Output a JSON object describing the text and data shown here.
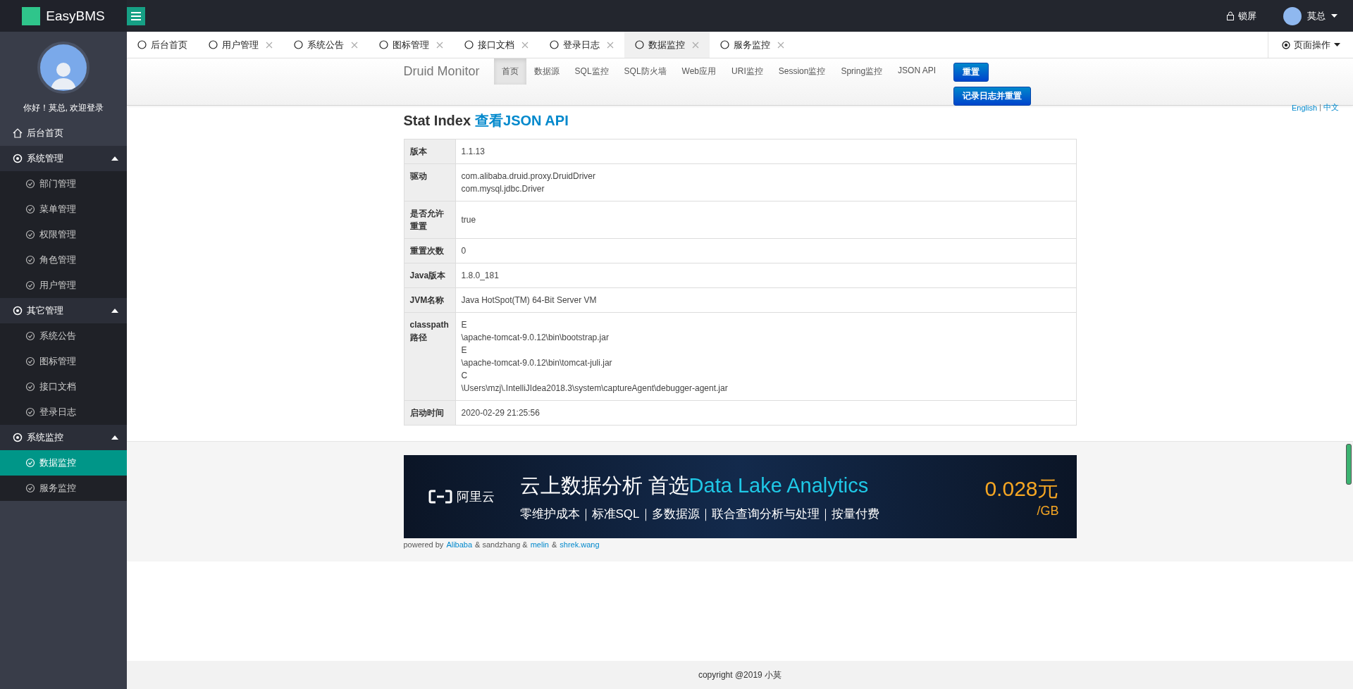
{
  "app": {
    "name": "EasyBMS"
  },
  "topbar": {
    "lock": "锁屏",
    "user": "莫总"
  },
  "sidebar": {
    "greeting": "你好！莫总, 欢迎登录",
    "items": [
      {
        "kind": "link",
        "label": "后台首页",
        "selected": false
      },
      {
        "kind": "group",
        "label": "系统管理",
        "expanded": true,
        "children": [
          {
            "label": "部门管理",
            "selected": false
          },
          {
            "label": "菜单管理",
            "selected": false
          },
          {
            "label": "权限管理",
            "selected": false
          },
          {
            "label": "角色管理",
            "selected": false
          },
          {
            "label": "用户管理",
            "selected": false
          }
        ]
      },
      {
        "kind": "group",
        "label": "其它管理",
        "expanded": true,
        "children": [
          {
            "label": "系统公告",
            "selected": false
          },
          {
            "label": "图标管理",
            "selected": false
          },
          {
            "label": "接口文档",
            "selected": false
          },
          {
            "label": "登录日志",
            "selected": false
          }
        ]
      },
      {
        "kind": "group",
        "label": "系统监控",
        "expanded": true,
        "children": [
          {
            "label": "数据监控",
            "selected": true
          },
          {
            "label": "服务监控",
            "selected": false
          }
        ]
      }
    ]
  },
  "tabs": [
    {
      "label": "后台首页",
      "closable": false,
      "selected": false
    },
    {
      "label": "用户管理",
      "closable": true,
      "selected": false
    },
    {
      "label": "系统公告",
      "closable": true,
      "selected": false
    },
    {
      "label": "图标管理",
      "closable": true,
      "selected": false
    },
    {
      "label": "接口文档",
      "closable": true,
      "selected": false
    },
    {
      "label": "登录日志",
      "closable": true,
      "selected": false
    },
    {
      "label": "数据监控",
      "closable": true,
      "selected": true
    },
    {
      "label": "服务监控",
      "closable": true,
      "selected": false
    }
  ],
  "page_actions": "页面操作",
  "druid": {
    "brand": "Druid Monitor",
    "nav": [
      {
        "label": "首页",
        "selected": true
      },
      {
        "label": "数据源",
        "selected": false
      },
      {
        "label": "SQL监控",
        "selected": false
      },
      {
        "label": "SQL防火墙",
        "selected": false
      },
      {
        "label": "Web应用",
        "selected": false
      },
      {
        "label": "URI监控",
        "selected": false
      },
      {
        "label": "Session监控",
        "selected": false
      },
      {
        "label": "Spring监控",
        "selected": false
      },
      {
        "label": "JSON API",
        "selected": false
      }
    ],
    "buttons": [
      "重置",
      "记录日志并重置"
    ],
    "languages": [
      "English",
      "中文"
    ],
    "title": "Stat Index",
    "title_link": "查看JSON API",
    "rows": [
      {
        "label": "版本",
        "lines": [
          "1.1.13"
        ]
      },
      {
        "label": "驱动",
        "lines": [
          "com.alibaba.druid.proxy.DruidDriver",
          "com.mysql.jdbc.Driver"
        ]
      },
      {
        "label": "是否允许重置",
        "lines": [
          "true"
        ]
      },
      {
        "label": "重置次数",
        "lines": [
          "0"
        ]
      },
      {
        "label": "Java版本",
        "lines": [
          "1.8.0_181"
        ]
      },
      {
        "label": "JVM名称",
        "lines": [
          "Java HotSpot(TM) 64-Bit Server VM"
        ]
      },
      {
        "label": "classpath路径",
        "lines": [
          "E",
          "\\apache-tomcat-9.0.12\\bin\\bootstrap.jar",
          "E",
          "\\apache-tomcat-9.0.12\\bin\\tomcat-juli.jar",
          "C",
          "\\Users\\mzj\\.IntelliJIdea2018.3\\system\\captureAgent\\debugger-agent.jar"
        ]
      },
      {
        "label": "启动时间",
        "lines": [
          "2020-02-29 21:25:56"
        ]
      }
    ],
    "banner": {
      "logo": "阿里云",
      "headline": "云上数据分析 首选",
      "headline_highlight": "Data Lake Analytics",
      "subline": "零维护成本｜标准SQL｜多数据源｜联合查询分析与处理｜按量付费",
      "price": "0.028元",
      "unit": "/GB"
    },
    "powered": [
      {
        "kind": "text",
        "text": "powered by"
      },
      {
        "kind": "link",
        "text": "Alibaba"
      },
      {
        "kind": "text",
        "text": "& sandzhang &"
      },
      {
        "kind": "link",
        "text": "melin"
      },
      {
        "kind": "text",
        "text": "&"
      },
      {
        "kind": "link",
        "text": "shrek.wang"
      }
    ]
  },
  "footer": "copyright @2019 小莫"
}
